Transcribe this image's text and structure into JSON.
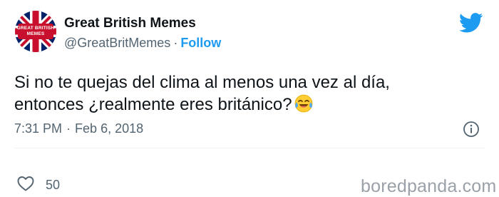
{
  "author": {
    "display_name": "Great British Memes",
    "handle": "@GreatBritMemes",
    "separator": "·",
    "follow_label": "Follow",
    "avatar_text_line1": "GREAT BRITISH",
    "avatar_text_line2": "MEMES"
  },
  "tweet": {
    "line1": "Si no te quejas del clima al menos una vez al día,",
    "line2": "entonces ¿realmente eres británico?",
    "emoji": "face-with-tears-of-joy"
  },
  "meta": {
    "time": "7:31 PM",
    "separator": "·",
    "date": "Feb 6, 2018"
  },
  "actions": {
    "like_count": "50"
  },
  "watermark": "boredpanda.com",
  "colors": {
    "accent": "#1d9bf0",
    "text": "#0f1419",
    "secondary": "#536471",
    "avatar_bg": "#c8102e",
    "flag_blue": "#012169"
  },
  "icons": {
    "brand": "twitter-bird-icon",
    "info": "info-icon",
    "like": "heart-icon"
  }
}
